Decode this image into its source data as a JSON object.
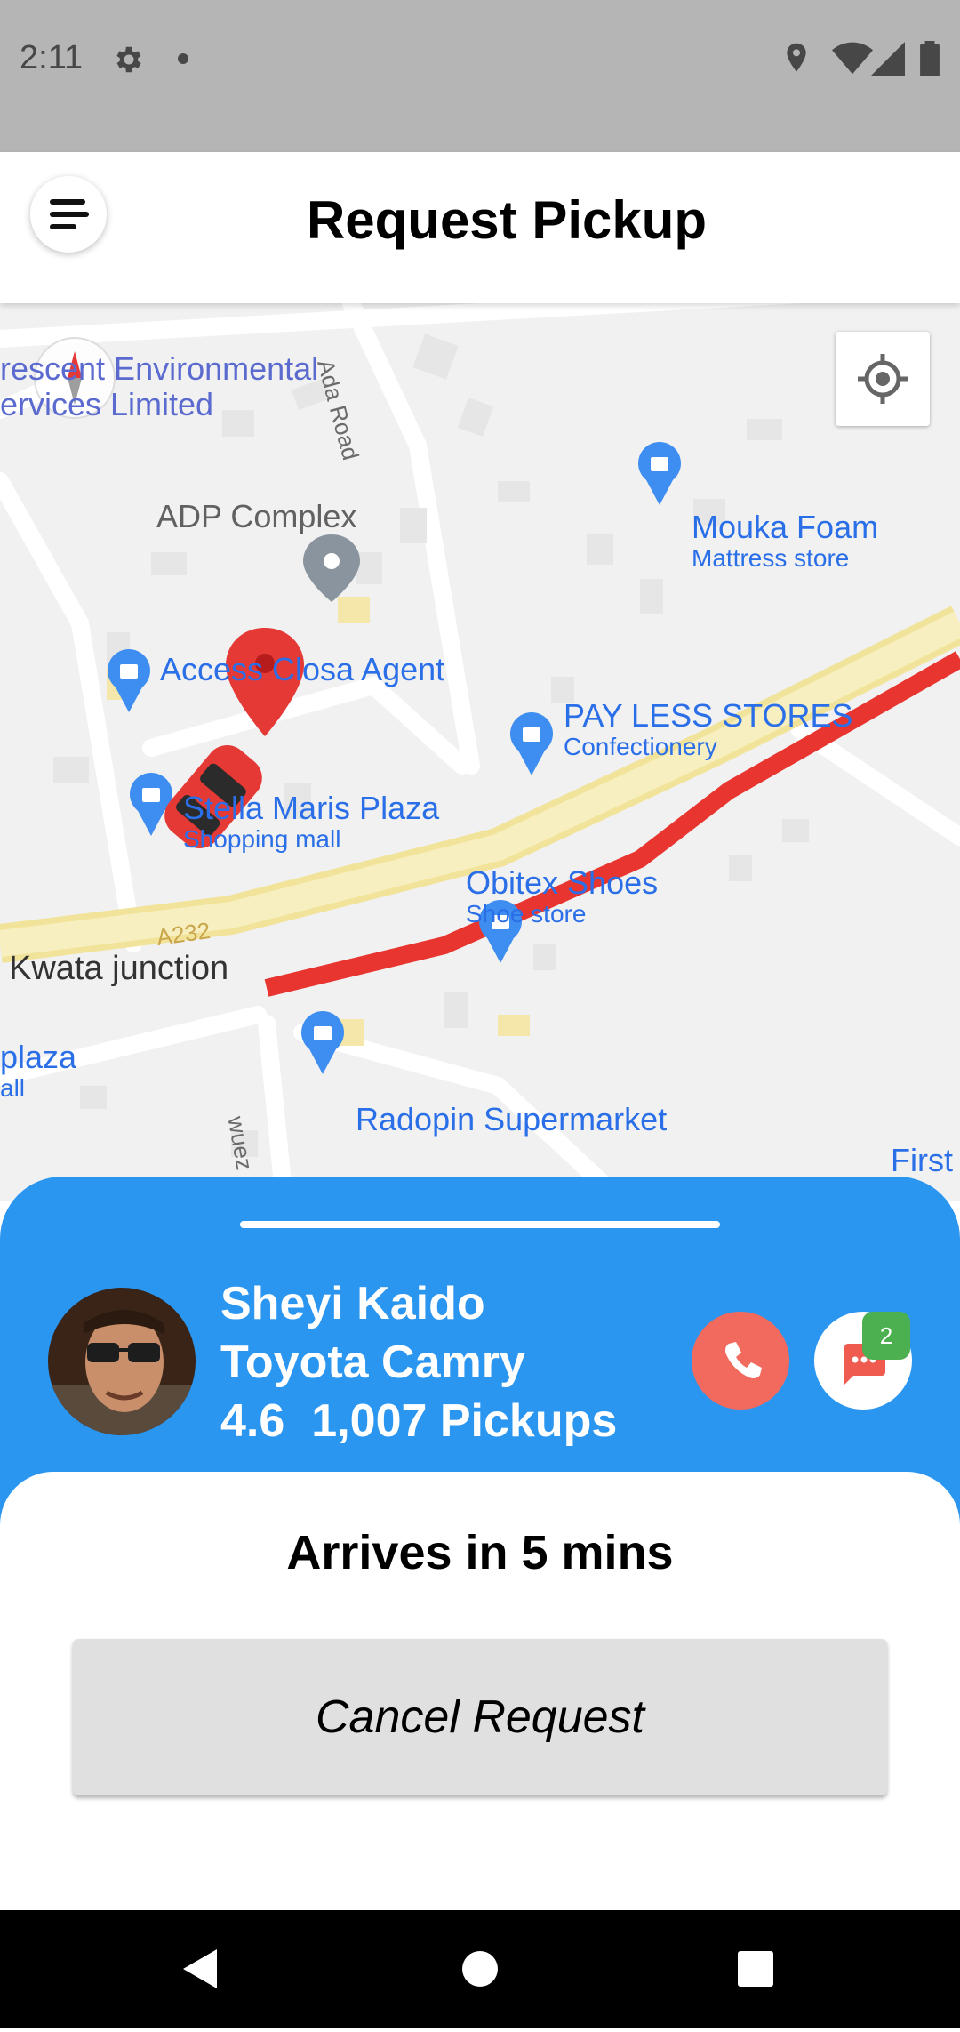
{
  "status_bar": {
    "time": "2:11"
  },
  "header": {
    "title": "Request Pickup"
  },
  "map": {
    "places": {
      "crescent_line1": "rescent Environmental",
      "crescent_line2": "ervices Limited",
      "adp_complex": "ADP Complex",
      "mouka_name": "Mouka Foam",
      "mouka_type": "Mattress store",
      "access_closa": "Access Closa Agent",
      "payless_name": "PAY LESS STORES",
      "payless_type": "Confectionery",
      "stella_name": "Stella Maris Plaza",
      "stella_type": "Shopping mall",
      "obitex_name": "Obitex Shoes",
      "obitex_type": "Shoe store",
      "kwata": "Kwata junction",
      "plaza_line1": "plaza",
      "plaza_line2": "all",
      "radopin": "Radopin Supermarket",
      "first": "First"
    },
    "roads": {
      "ada_road": "Ada Road",
      "a232": "A232",
      "wuez": "wuez"
    }
  },
  "driver": {
    "name": "Sheyi Kaido",
    "car": "Toyota Camry",
    "rating": "4.6",
    "pickups": "1,007 Pickups",
    "unread_messages": "2"
  },
  "trip": {
    "eta": "Arrives in 5 mins",
    "cancel_label": "Cancel Request"
  },
  "colors": {
    "accent": "#2b96f0",
    "call": "#f26a5e",
    "badge": "#4caf50",
    "route": "#e8352f"
  }
}
